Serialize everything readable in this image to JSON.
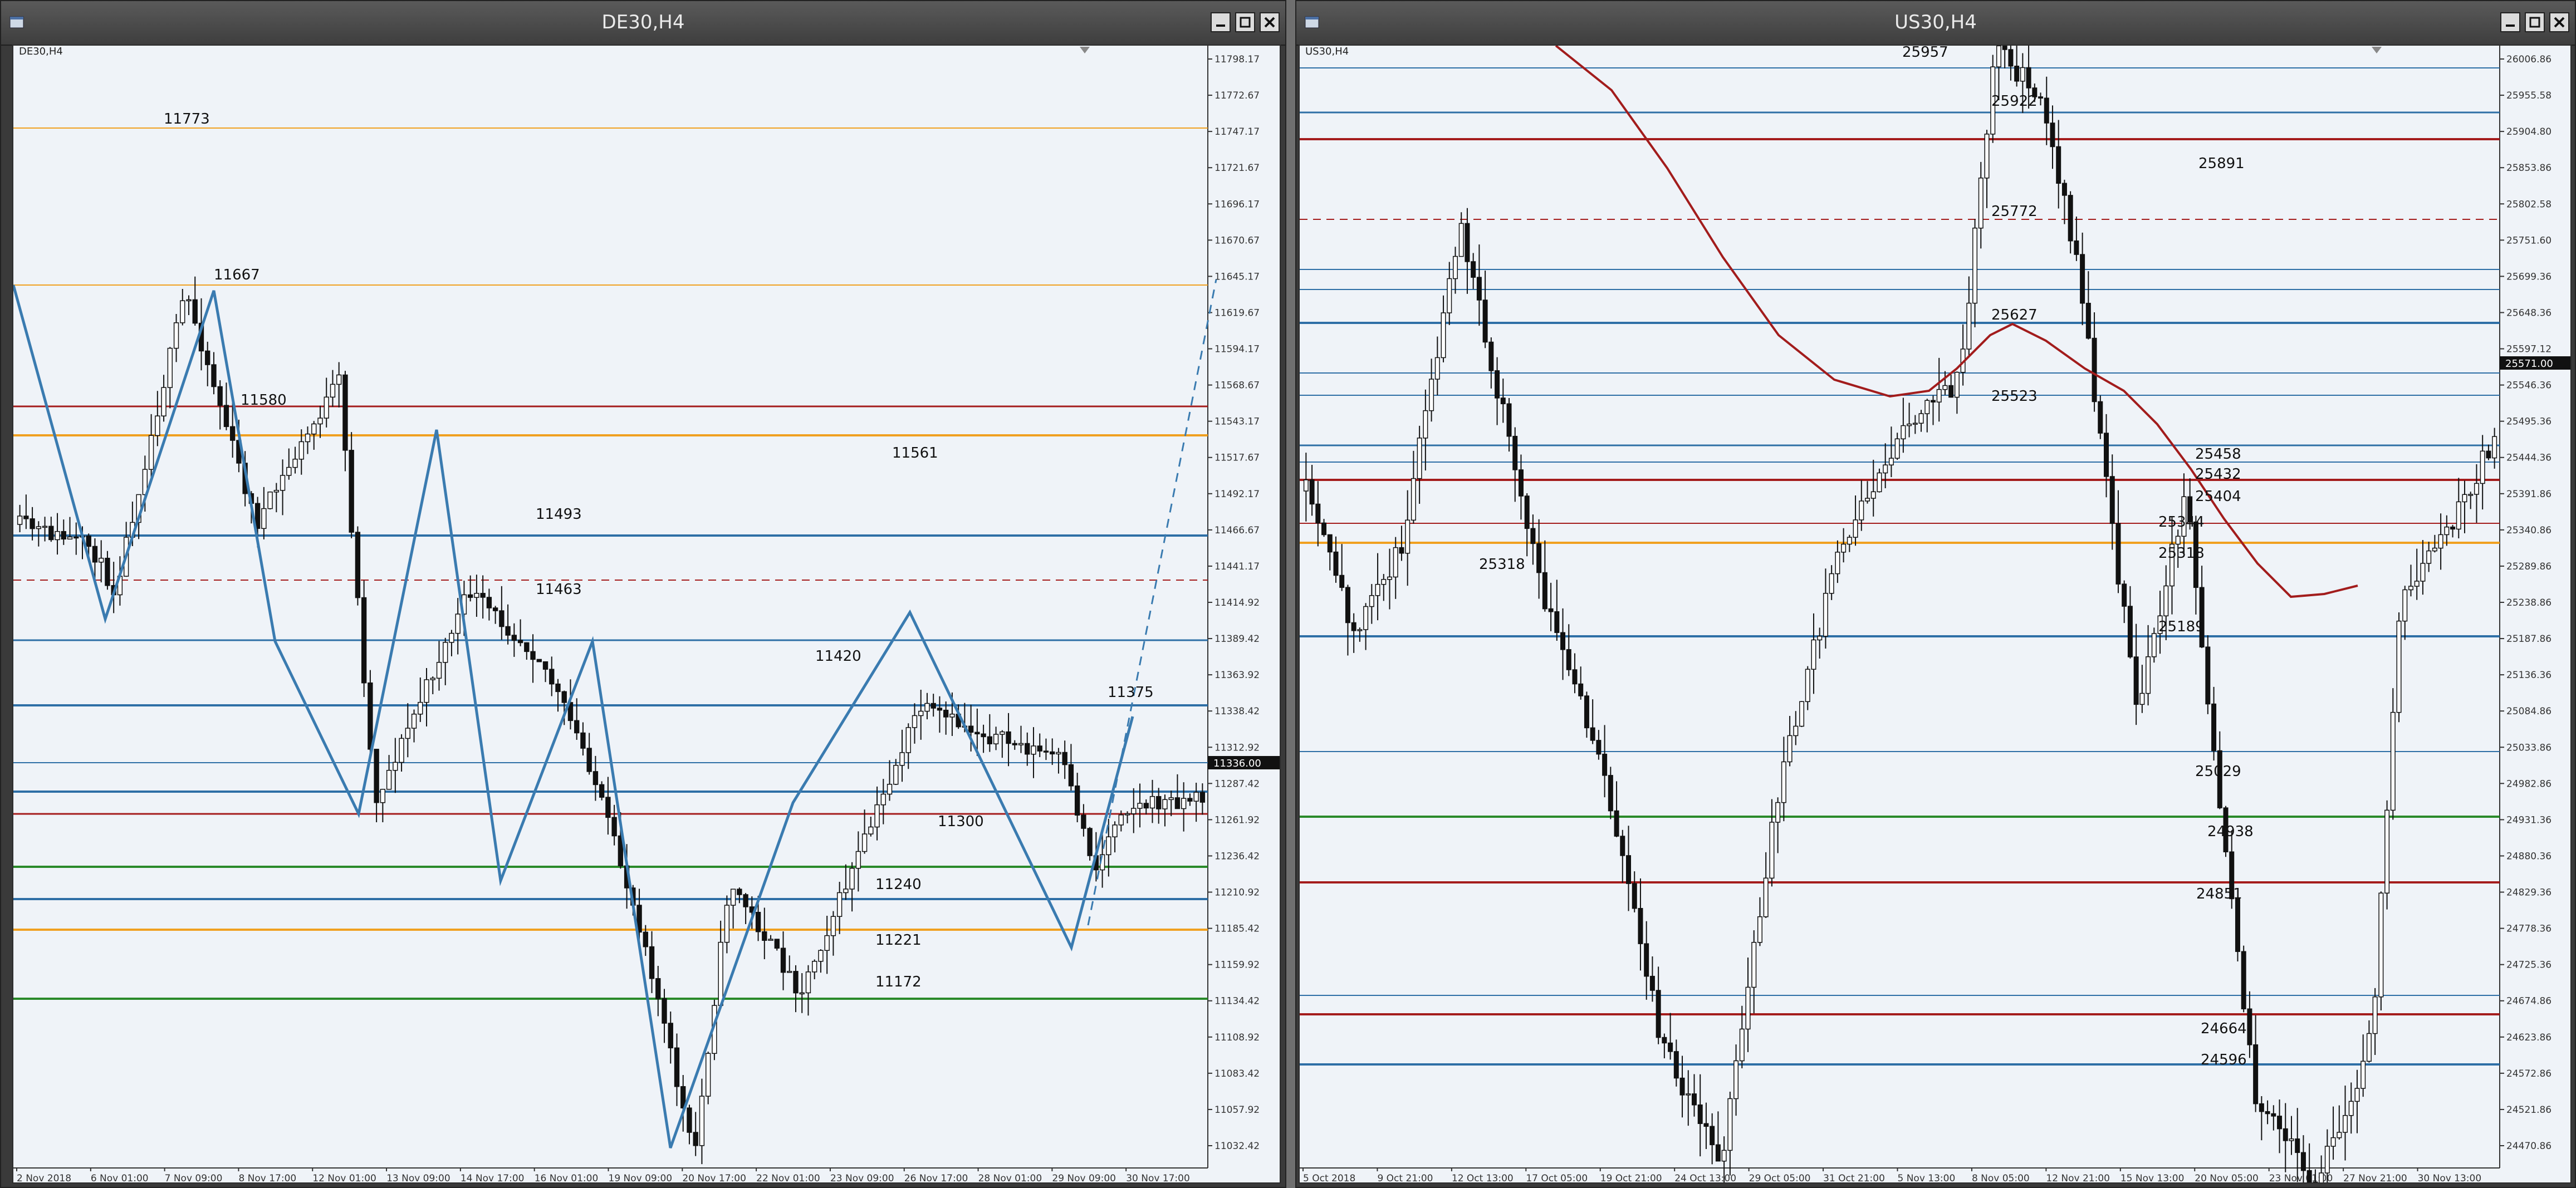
{
  "windows": [
    {
      "id": "de30",
      "title": "DE30,H4",
      "symbol_label": "DE30,H4",
      "price_axis": [
        "11798.17",
        "11772.67",
        "11747.17",
        "11721.67",
        "11696.17",
        "11670.67",
        "11645.17",
        "11619.67",
        "11594.17",
        "11568.67",
        "11543.17",
        "11517.67",
        "11492.17",
        "11466.67",
        "11441.17",
        "11414.92",
        "11389.42",
        "11363.92",
        "11338.42",
        "11312.92",
        "11287.42",
        "11261.92",
        "11236.42",
        "11210.92",
        "11185.42",
        "11159.92",
        "11134.42",
        "11108.92",
        "11083.42",
        "11057.92",
        "11032.42"
      ],
      "current_price": "11336.00",
      "time_axis": [
        "2 Nov 2018",
        "6 Nov 01:00",
        "7 Nov 09:00",
        "8 Nov 17:00",
        "12 Nov 01:00",
        "13 Nov 09:00",
        "14 Nov 17:00",
        "16 Nov 01:00",
        "19 Nov 09:00",
        "20 Nov 17:00",
        "22 Nov 01:00",
        "23 Nov 09:00",
        "26 Nov 17:00",
        "28 Nov 01:00",
        "29 Nov 09:00",
        "30 Nov 17:00"
      ],
      "level_labels": [
        "11773",
        "11667",
        "11580",
        "11561",
        "11493",
        "11463",
        "11420",
        "11375",
        "11300",
        "11240",
        "11221",
        "11172"
      ]
    },
    {
      "id": "us30",
      "title": "US30,H4",
      "symbol_label": "US30,H4",
      "price_axis": [
        "26006.86",
        "25955.58",
        "25904.80",
        "25853.86",
        "25802.58",
        "25751.60",
        "25699.36",
        "25648.36",
        "25597.12",
        "25546.36",
        "25495.36",
        "25444.36",
        "25391.86",
        "25340.86",
        "25289.86",
        "25238.86",
        "25187.86",
        "25136.36",
        "25084.86",
        "25033.86",
        "24982.86",
        "24931.36",
        "24880.36",
        "24829.36",
        "24778.36",
        "24725.36",
        "24674.86",
        "24623.86",
        "24572.86",
        "24521.86",
        "24470.86"
      ],
      "current_price": "25571.00",
      "time_axis": [
        "5 Oct 2018",
        "9 Oct 21:00",
        "12 Oct 13:00",
        "17 Oct 05:00",
        "19 Oct 21:00",
        "24 Oct 13:00",
        "29 Oct 05:00",
        "31 Oct 21:00",
        "5 Nov 13:00",
        "8 Nov 05:00",
        "12 Nov 21:00",
        "15 Nov 13:00",
        "20 Nov 05:00",
        "23 Nov 01:00",
        "27 Nov 21:00",
        "30 Nov 13:00"
      ],
      "level_labels": [
        "25957",
        "25922",
        "25891",
        "25772",
        "25627",
        "25523",
        "25458",
        "25432",
        "25404",
        "25344",
        "25318",
        "25318",
        "25189",
        "25029",
        "24938",
        "24851",
        "24664",
        "24596"
      ]
    }
  ],
  "colors": {
    "chart_bg": "#eff3f8",
    "blue_level": "#2e6fa6",
    "red_level": "#a41c1c",
    "orange_level": "#f0a020",
    "green_level": "#2a8a2a",
    "zigzag": "#3a7bb0",
    "ma_line": "#a21c1c"
  }
}
